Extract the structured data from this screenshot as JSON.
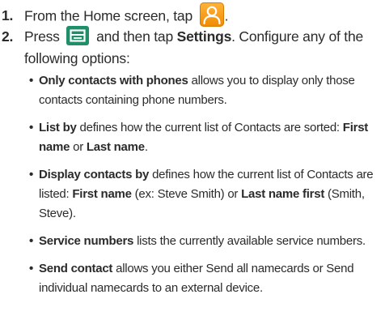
{
  "steps": [
    {
      "number": "1.",
      "text_before_icon": "From the Home screen, tap",
      "icon": "contacts-icon",
      "text_after_icon": "."
    },
    {
      "number": "2.",
      "text_press": "Press",
      "icon": "menu-key-icon",
      "text_then_tap": "and then tap",
      "settings_label": "Settings",
      "text_after": ". Configure any of the following options:"
    }
  ],
  "options": [
    {
      "title": "Only contacts with phones",
      "desc": "allows you to display only those contacts containing phone numbers."
    },
    {
      "title": "List by",
      "desc": "defines how the current list of Contacts are sorted:",
      "value_a": "First name",
      "connector": "or",
      "value_b": "Last name",
      "end": "."
    },
    {
      "title": "Display contacts by",
      "desc": "defines how the current list of Contacts are listed:",
      "value_a": "First name",
      "example_a": "(ex: Steve Smith) or",
      "value_b": "Last name first",
      "example_b": "(Smith, Steve)."
    },
    {
      "title": "Service numbers",
      "desc": "lists the currently available service numbers."
    },
    {
      "title": "Send contact",
      "desc": "allows you either Send all namecards or Send individual namecards to an external device."
    }
  ],
  "bullet": "•",
  "colors": {
    "text": "#2b2b2b",
    "contacts_icon": "#f59a16",
    "menu_key_icon": "#1f8f6a"
  }
}
